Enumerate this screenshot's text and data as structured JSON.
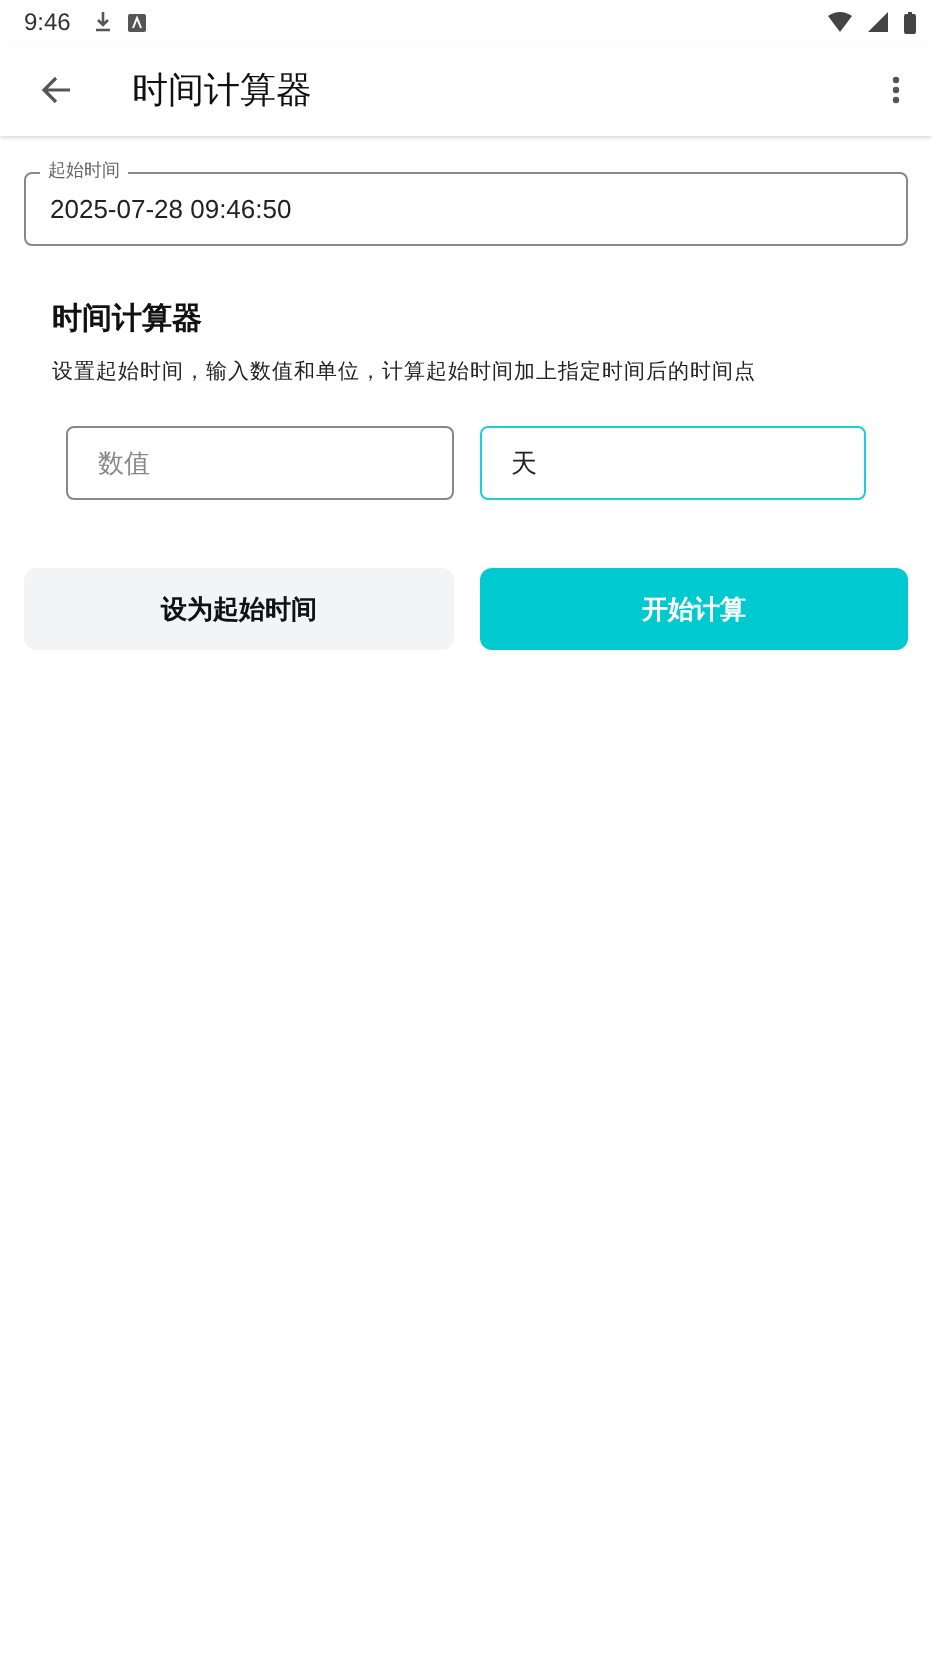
{
  "status_bar": {
    "time": "9:46"
  },
  "app_bar": {
    "title": "时间计算器"
  },
  "start_time": {
    "label": "起始时间",
    "value": "2025-07-28 09:46:50"
  },
  "section": {
    "title": "时间计算器",
    "description": "设置起始时间，输入数值和单位，计算起始时间加上指定时间后的时间点"
  },
  "fields": [
    {
      "placeholder": "数值",
      "focused": false
    },
    {
      "value": "天",
      "focused": true
    }
  ],
  "buttons": [
    {
      "label": "设为起始时间",
      "kind": "secondary"
    },
    {
      "label": "开始计算",
      "kind": "primary"
    }
  ]
}
